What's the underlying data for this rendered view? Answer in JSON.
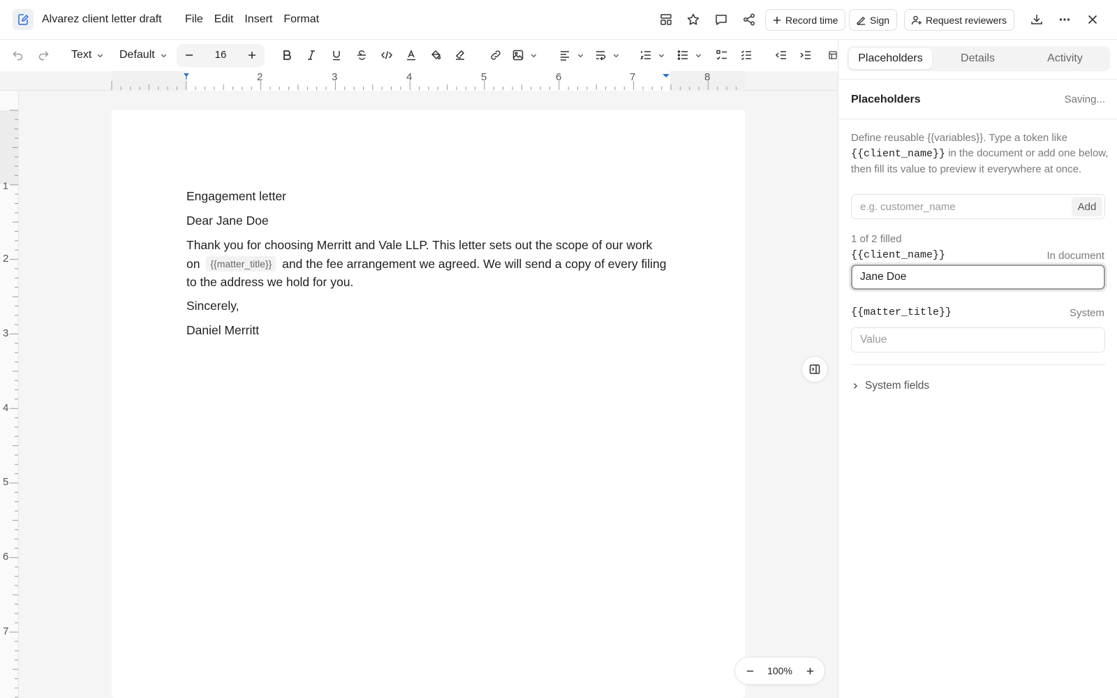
{
  "app": {
    "doc_title": "Alvarez client letter draft",
    "menu": [
      "File",
      "Edit",
      "Insert",
      "Format"
    ]
  },
  "top_actions": {
    "record_time": "Record time",
    "sign": "Sign",
    "request_reviewers": "Request reviewers"
  },
  "toolbar": {
    "block_type": "Text",
    "font_style": "Default",
    "font_size": "16"
  },
  "ruler": {
    "horizontal_numbers": [
      "2",
      "3",
      "4",
      "5",
      "6",
      "7",
      "8"
    ],
    "vertical_numbers": [
      "1",
      "2",
      "3",
      "4",
      "5",
      "6",
      "7"
    ]
  },
  "document": {
    "heading": "Engagement letter",
    "salutation": "Dear Jane Doe",
    "para_before": "Thank you for choosing Merritt and Vale LLP. This letter sets out the scope of our work on",
    "placeholder_chip": "{{matter_title}}",
    "para_after": "and the fee arrangement we agreed. We will send a copy of every filing to the address we hold for you.",
    "closing": "Sincerely,",
    "signature": "Daniel Merritt"
  },
  "zoom": {
    "value": "100%"
  },
  "panel": {
    "tabs": [
      {
        "label": "Placeholders",
        "active": true
      },
      {
        "label": "Details",
        "active": false
      },
      {
        "label": "Activity",
        "active": false
      }
    ],
    "title": "Placeholders",
    "status": "Saving...",
    "desc_1": "Define reusable {{variables}}. Type a token like",
    "desc_token": "{{client_name}}",
    "desc_2": "in the document or add one below, then fill its value to preview it everywhere at once.",
    "new_placeholder": {
      "placeholder": "e.g. customer_name",
      "value": ""
    },
    "add_label": "Add",
    "filled_count": "1 of 2 filled",
    "placeholders": [
      {
        "token": "{{client_name}}",
        "tag": "In document",
        "value": "Jane Doe",
        "placeholder": "Value"
      },
      {
        "token": "{{matter_title}}",
        "tag": "System",
        "value": "",
        "placeholder": "Value"
      }
    ],
    "system_fields_label": "System fields"
  },
  "colors": {
    "accent": "#2f6fd6",
    "border": "#e2e2e2",
    "muted_text": "#7a7a7a"
  }
}
